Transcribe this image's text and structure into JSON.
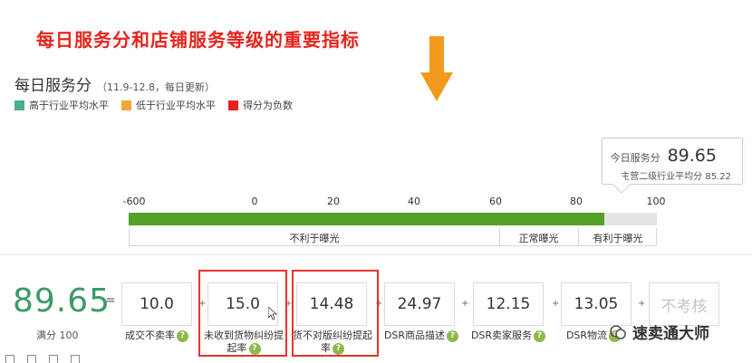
{
  "headline": "每日服务分和店铺服务等级的重要指标",
  "section": {
    "title": "每日服务分",
    "subtitle": "（11.9-12.8，每日更新）"
  },
  "legend": [
    {
      "label": "高于行业平均水平",
      "color": "#4aaf8c"
    },
    {
      "label": "低于行业平均水平",
      "color": "#f5a53a"
    },
    {
      "label": "得分为负数",
      "color": "#e8231d"
    }
  ],
  "tooltip": {
    "today_label": "今日服务分",
    "today_value": "89.65",
    "industry_label": "主营二级行业平均分",
    "industry_value": "85.22"
  },
  "scale": {
    "ticks": [
      "-600",
      "0",
      "20",
      "40",
      "60",
      "80",
      "100"
    ],
    "progress_fraction": 0.9
  },
  "zones": [
    "不利于曝光",
    "正常曝光",
    "有利于曝光"
  ],
  "score": {
    "value": "89.65",
    "equals": "=",
    "full_label": "满分 100"
  },
  "metrics": [
    {
      "value": "10.0",
      "label": "成交不卖率",
      "label2": ""
    },
    {
      "value": "15.0",
      "label": "未收到货物纠纷提",
      "label2": "起率"
    },
    {
      "value": "14.48",
      "label": "货不对版纠纷提起",
      "label2": "率"
    },
    {
      "value": "24.97",
      "label": "DSR商品描述",
      "label2": ""
    },
    {
      "value": "12.15",
      "label": "DSR卖家服务",
      "label2": ""
    },
    {
      "value": "13.05",
      "label": "DSR物流",
      "label2": ""
    },
    {
      "value": "不考核",
      "label": "",
      "label2": ""
    }
  ],
  "plus": "+",
  "help": "?",
  "watermark": "速卖通大师",
  "colors": {
    "headline": "#e8231d",
    "progress": "#52a22a",
    "score": "#3c9a66",
    "highlight": "#e8352b",
    "arrow": "#f39a1e"
  }
}
